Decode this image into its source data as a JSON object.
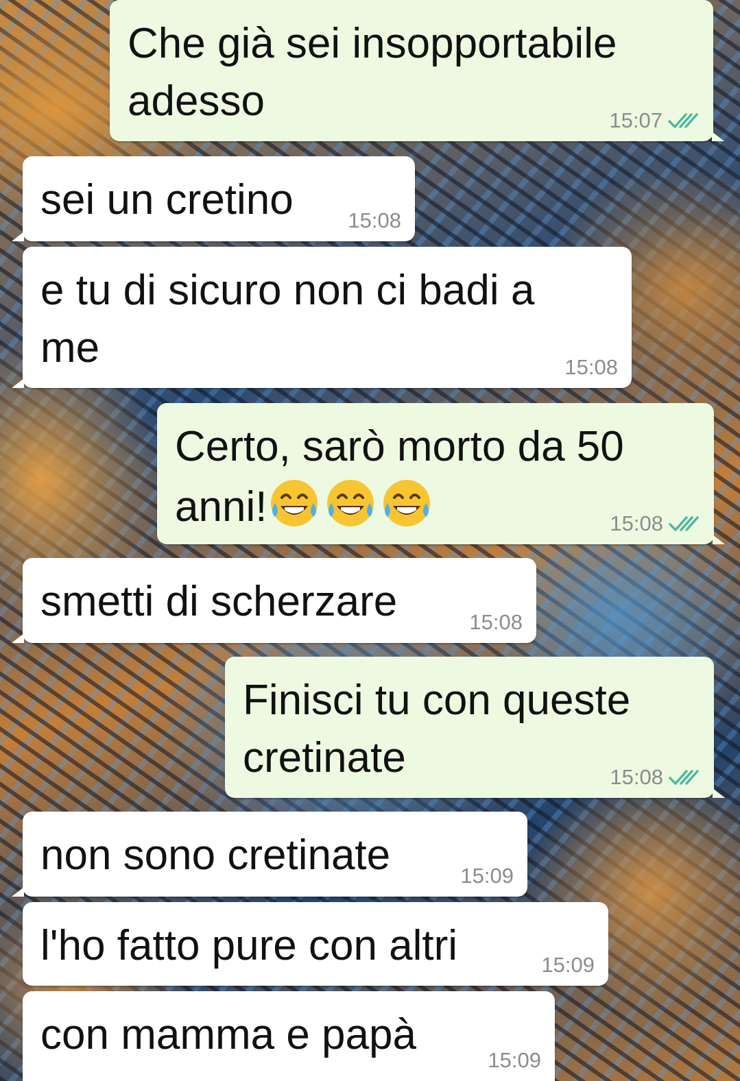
{
  "chat": {
    "messages": [
      {
        "direction": "out",
        "text": "Che già sei insopportabile\nadesso",
        "time": "15:07",
        "status": "read"
      },
      {
        "direction": "in",
        "text": "sei un cretino",
        "time": "15:08"
      },
      {
        "direction": "in",
        "text": "e tu di sicuro non ci badi a\nme",
        "time": "15:08"
      },
      {
        "direction": "out",
        "text": "Certo, sarò morto da 50\nanni!",
        "emoji": [
          "face-with-tears-of-joy",
          "face-with-tears-of-joy",
          "face-with-tears-of-joy"
        ],
        "time": "15:08",
        "status": "read"
      },
      {
        "direction": "in",
        "text": "smetti di scherzare",
        "time": "15:08"
      },
      {
        "direction": "out",
        "text": "Finisci tu con queste\ncretinate",
        "time": "15:08",
        "status": "read"
      },
      {
        "direction": "in",
        "text": "non sono cretinate",
        "time": "15:09"
      },
      {
        "direction": "in",
        "text": "l'ho fatto pure con altri",
        "time": "15:09"
      },
      {
        "direction": "in",
        "text": "con mamma e papà",
        "time": "15:09"
      }
    ]
  },
  "colors": {
    "outgoing_bubble": "#eef9e1",
    "incoming_bubble": "#ffffff",
    "read_ticks": "#4fb8a0",
    "timestamp": "#8c8c8c"
  }
}
